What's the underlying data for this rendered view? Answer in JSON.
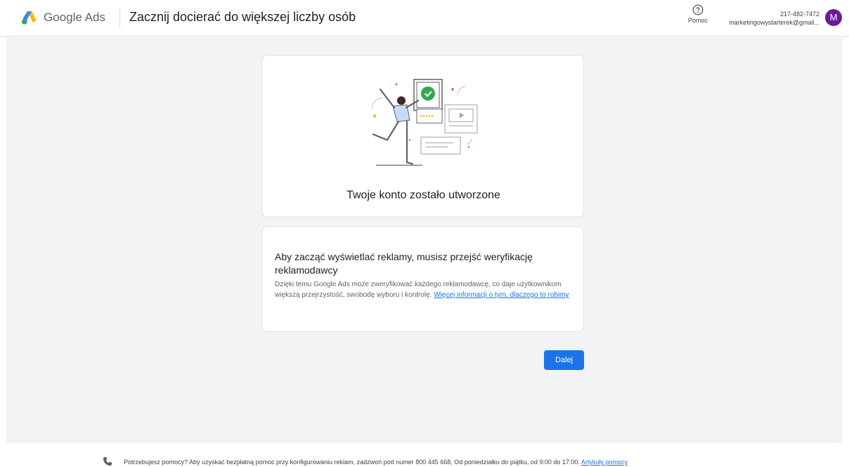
{
  "header": {
    "brand_google": "Google",
    "brand_ads": "Ads",
    "title": "Zacznij docierać do większej liczby osób",
    "help_label": "Pomoc",
    "account_id": "217-482-7472",
    "account_email": "marketingowystarterek@gmail...",
    "avatar_letter": "M"
  },
  "confirmation_card": {
    "title": "Twoje konto zostało utworzone"
  },
  "verification_card": {
    "title": "Aby zacząć wyświetlać reklamy, musisz przejść weryfikację reklamodawcy",
    "body": "Dzięki temu Google Ads może zweryfikować każdego reklamodawcę, co daje użytkownikom większą przejrzystość, swobodę wyboru i kontrolę.",
    "link": "Więcej informacji o tym, dlaczego to robimy"
  },
  "actions": {
    "next_label": "Dalej"
  },
  "footer": {
    "text": "Potrzebujesz pomocy? Aby uzyskać bezpłatną pomoc przy konfigurowaniu reklam, zadzwoń pod numer 800 445 668, Od poniedziałku do piątku, od 9:00 do 17:00.",
    "link": "Artykuły pomocy"
  },
  "icons": {
    "logo": "google-ads-logo",
    "help": "help-circle-icon",
    "phone": "phone-icon"
  },
  "colors": {
    "primary": "#1a73e8",
    "avatar": "#6a1b9a",
    "background": "#f1f3f4"
  }
}
